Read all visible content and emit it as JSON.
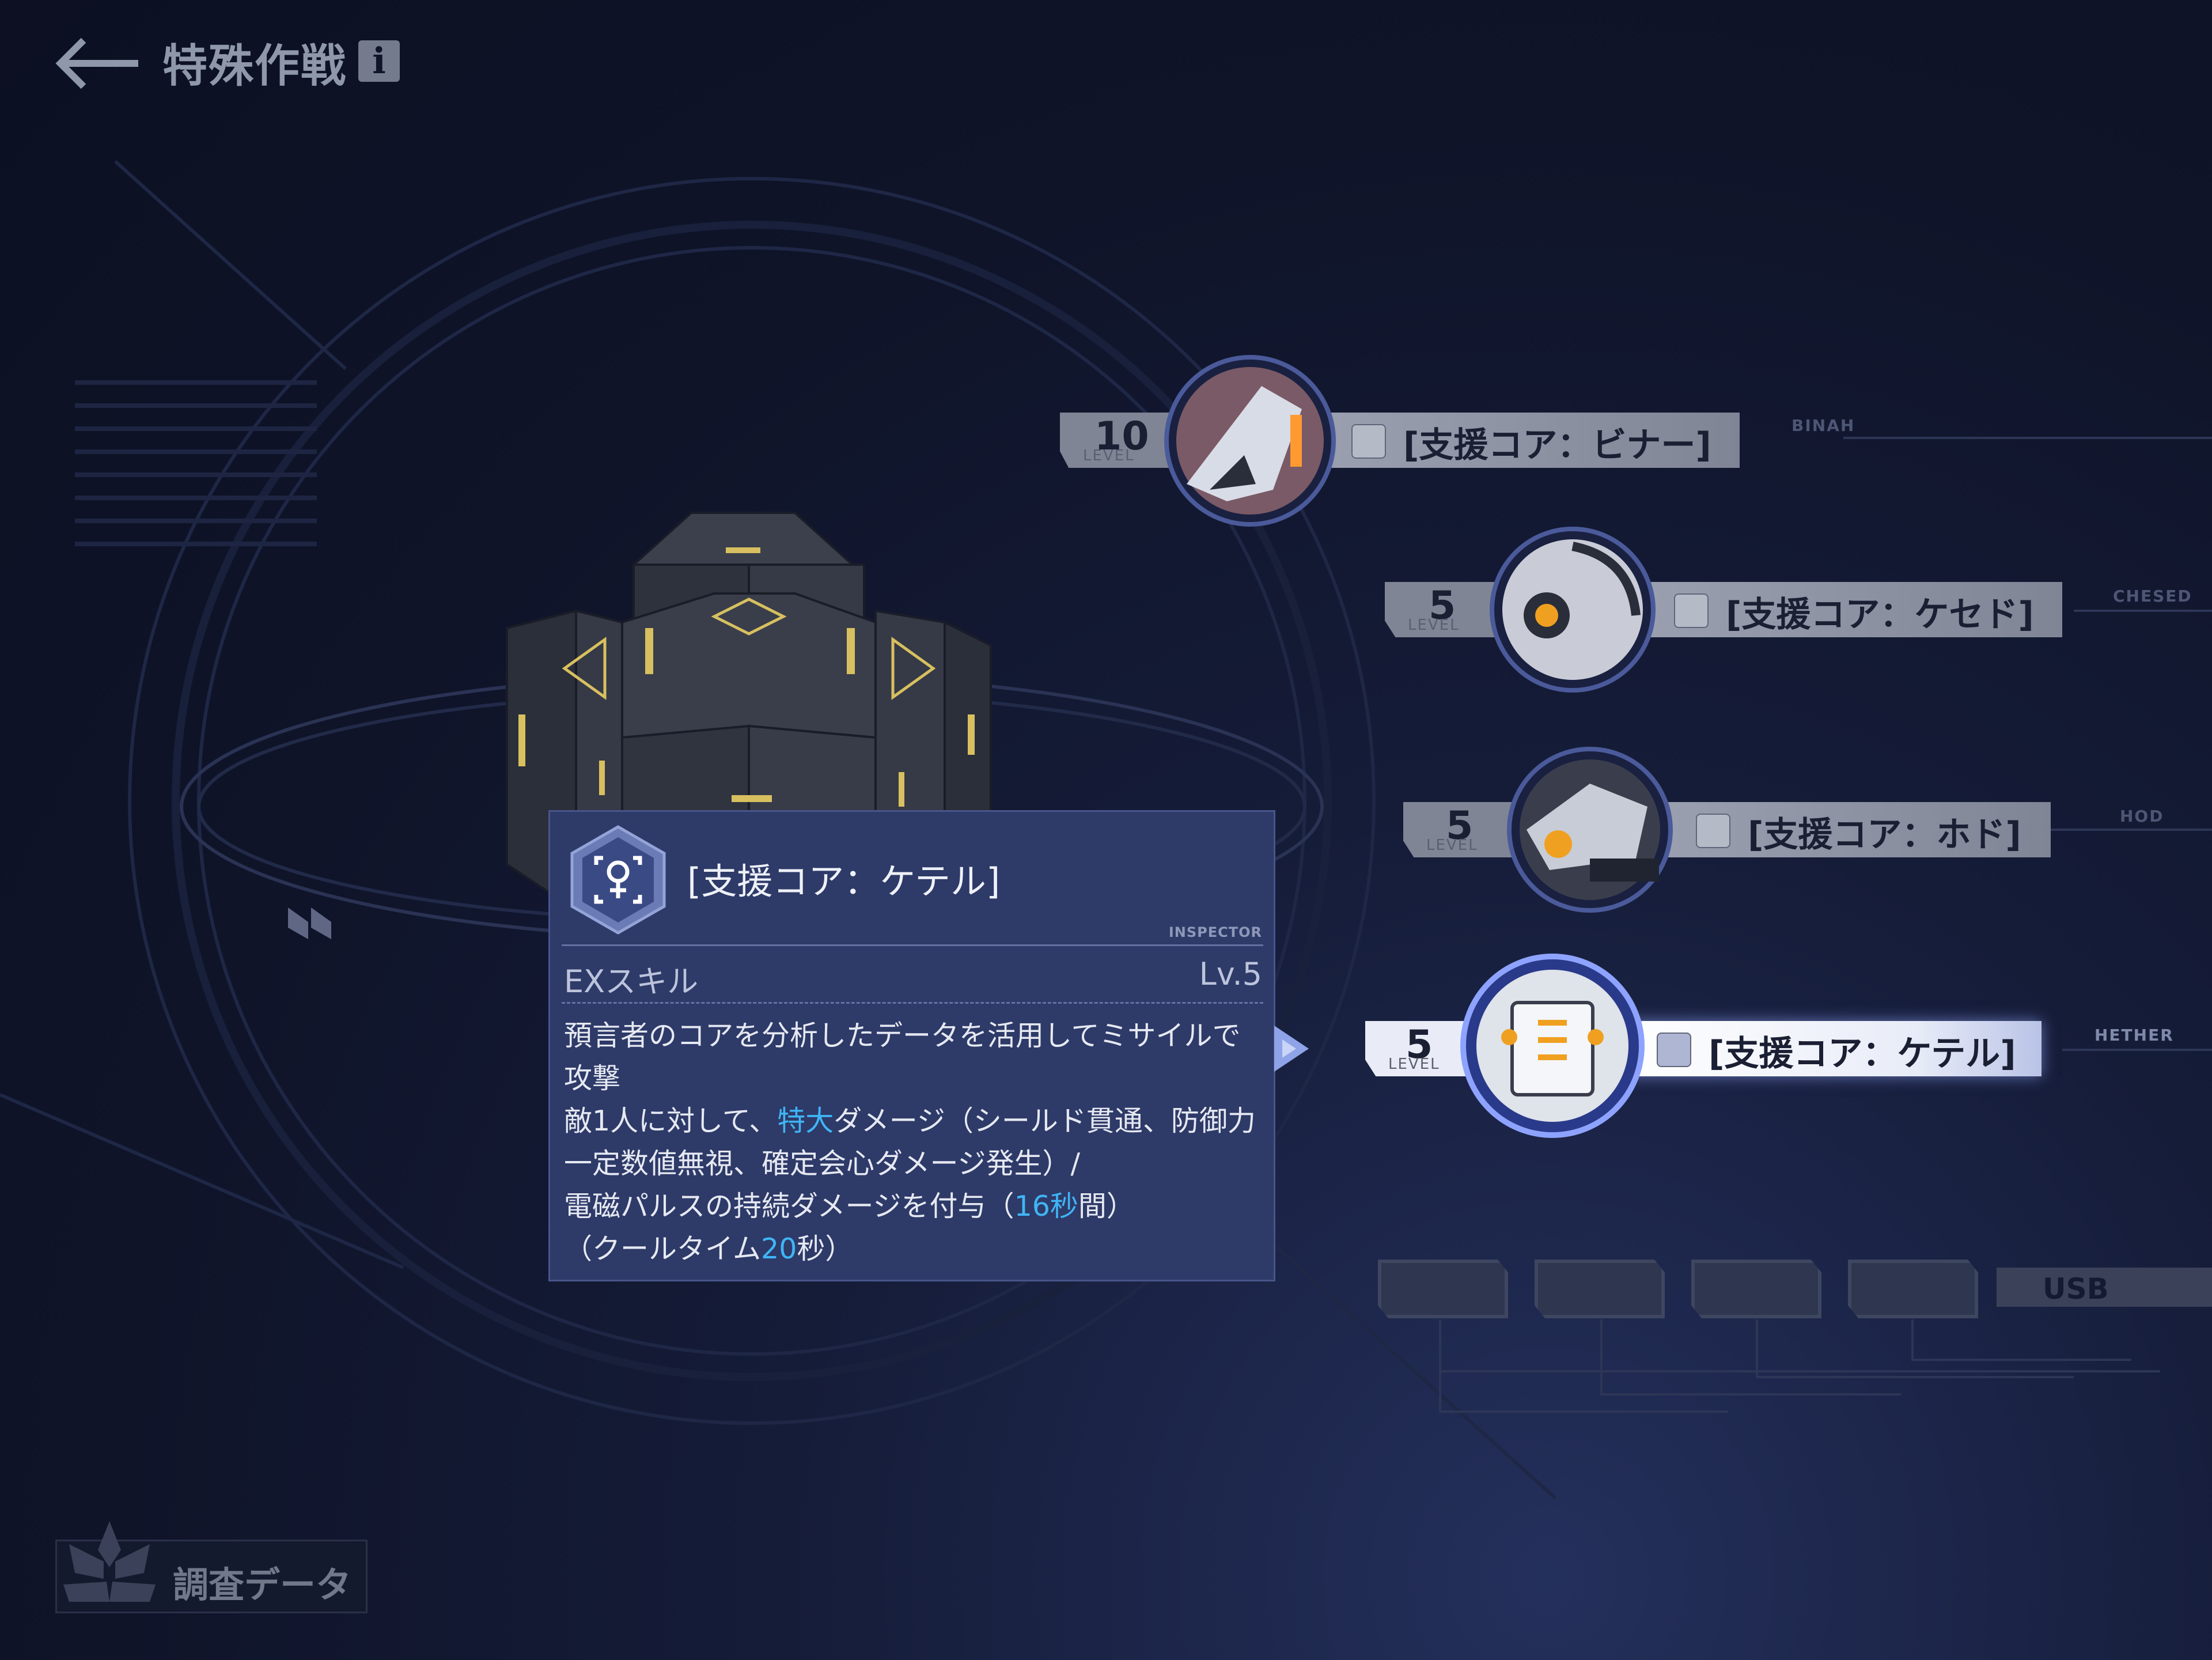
{
  "header": {
    "title": "特殊作戦",
    "info_glyph": "i"
  },
  "tooltip": {
    "title": "[支援コア：ケテル]",
    "inspector_tag": "INSPECTOR",
    "skill_label": "EXスキル",
    "skill_level": "Lv.5",
    "desc": {
      "line1": "預言者のコアを分析したデータを活用してミサイルで攻撃",
      "line2_pre": "敵1人に対して、",
      "line2_hl": "特大",
      "line2_post": "ダメージ（シールド貫通、防御力一定数値無視、確定会心ダメージ発生）/",
      "line3_pre": "電磁パルスの持続ダメージを付与（",
      "line3_hl": "16秒",
      "line3_post": "間）",
      "line4_pre": "（クールタイム",
      "line4_hl": "20",
      "line4_post": "秒）"
    }
  },
  "cores": [
    {
      "level": "10",
      "level_label": "LEVEL",
      "name": "[支援コア：ビナー]",
      "tag": "BINAH",
      "selected": false
    },
    {
      "level": "5",
      "level_label": "LEVEL",
      "name": "[支援コア：ケセド]",
      "tag": "CHESED",
      "selected": false
    },
    {
      "level": "5",
      "level_label": "LEVEL",
      "name": "[支援コア：ホド]",
      "tag": "HOD",
      "selected": false
    },
    {
      "level": "5",
      "level_label": "LEVEL",
      "name": "[支援コア：ケテル]",
      "tag": "HETHER",
      "selected": true
    }
  ],
  "usb_label": "USB",
  "survey_button": "調査データ",
  "colors": {
    "accent_blue": "#3fb5f5",
    "tooltip_bg": "#2e3a68",
    "background": "#0f1429"
  }
}
